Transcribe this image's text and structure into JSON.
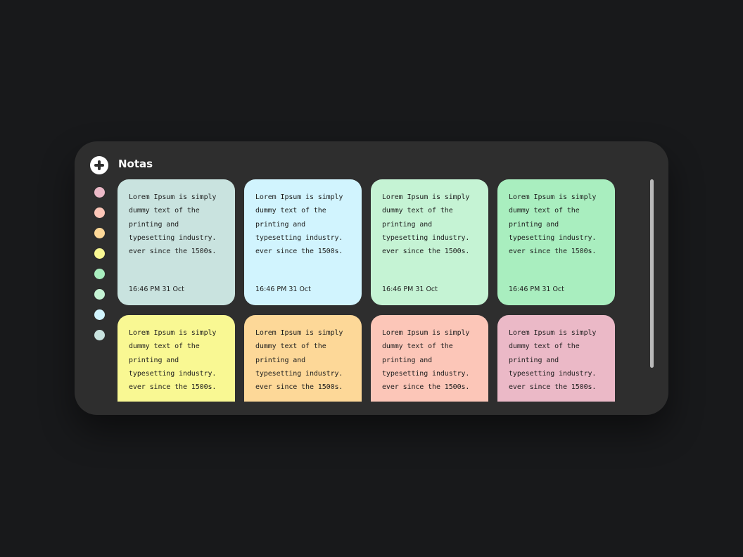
{
  "app": {
    "title": "Notas"
  },
  "colors": {
    "background": "#18191b",
    "panel": "#2e2e2e",
    "scrollbar": "#b9b9b9"
  },
  "palette": [
    {
      "name": "pink",
      "color": "#ebb9c7"
    },
    {
      "name": "salmon",
      "color": "#fcc6b8"
    },
    {
      "name": "orange",
      "color": "#fdd898"
    },
    {
      "name": "yellow",
      "color": "#f9f893"
    },
    {
      "name": "green",
      "color": "#a9eebf"
    },
    {
      "name": "mint",
      "color": "#c5f3d4"
    },
    {
      "name": "light-blue",
      "color": "#d1f4fe"
    },
    {
      "name": "grey-teal",
      "color": "#c9e3df"
    }
  ],
  "notes": [
    {
      "text": "Lorem Ipsum is simply\ndummy text of the\nprinting and\ntypesetting industry.\never since the 1500s.",
      "date": "16:46 PM 31 Oct",
      "color": "#c9e3df"
    },
    {
      "text": "Lorem Ipsum is simply\ndummy text of the\nprinting and\ntypesetting industry.\never since the 1500s.",
      "date": "16:46 PM 31 Oct",
      "color": "#d1f4fe"
    },
    {
      "text": "Lorem Ipsum is simply\ndummy text of the\nprinting and\ntypesetting industry.\never since the 1500s.",
      "date": "16:46 PM 31 Oct",
      "color": "#c5f3d4"
    },
    {
      "text": "Lorem Ipsum is simply\ndummy text of the\nprinting and\ntypesetting industry.\never since the 1500s.",
      "date": "16:46 PM 31 Oct",
      "color": "#a9eebf"
    },
    {
      "text": "Lorem Ipsum is simply\ndummy text of the\nprinting and\ntypesetting industry.\never since the 1500s.",
      "date": "",
      "color": "#f9f893"
    },
    {
      "text": "Lorem Ipsum is simply\ndummy text of the\nprinting and\ntypesetting industry.\never since the 1500s.",
      "date": "",
      "color": "#fdd898"
    },
    {
      "text": "Lorem Ipsum is simply\ndummy text of the\nprinting and\ntypesetting industry.\never since the 1500s.",
      "date": "",
      "color": "#fcc6b8"
    },
    {
      "text": "Lorem Ipsum is simply\ndummy text of the\nprinting and\ntypesetting industry.\never since the 1500s.",
      "date": "",
      "color": "#ebb9c7"
    }
  ],
  "icons": {
    "add": "plus-circle-icon"
  }
}
